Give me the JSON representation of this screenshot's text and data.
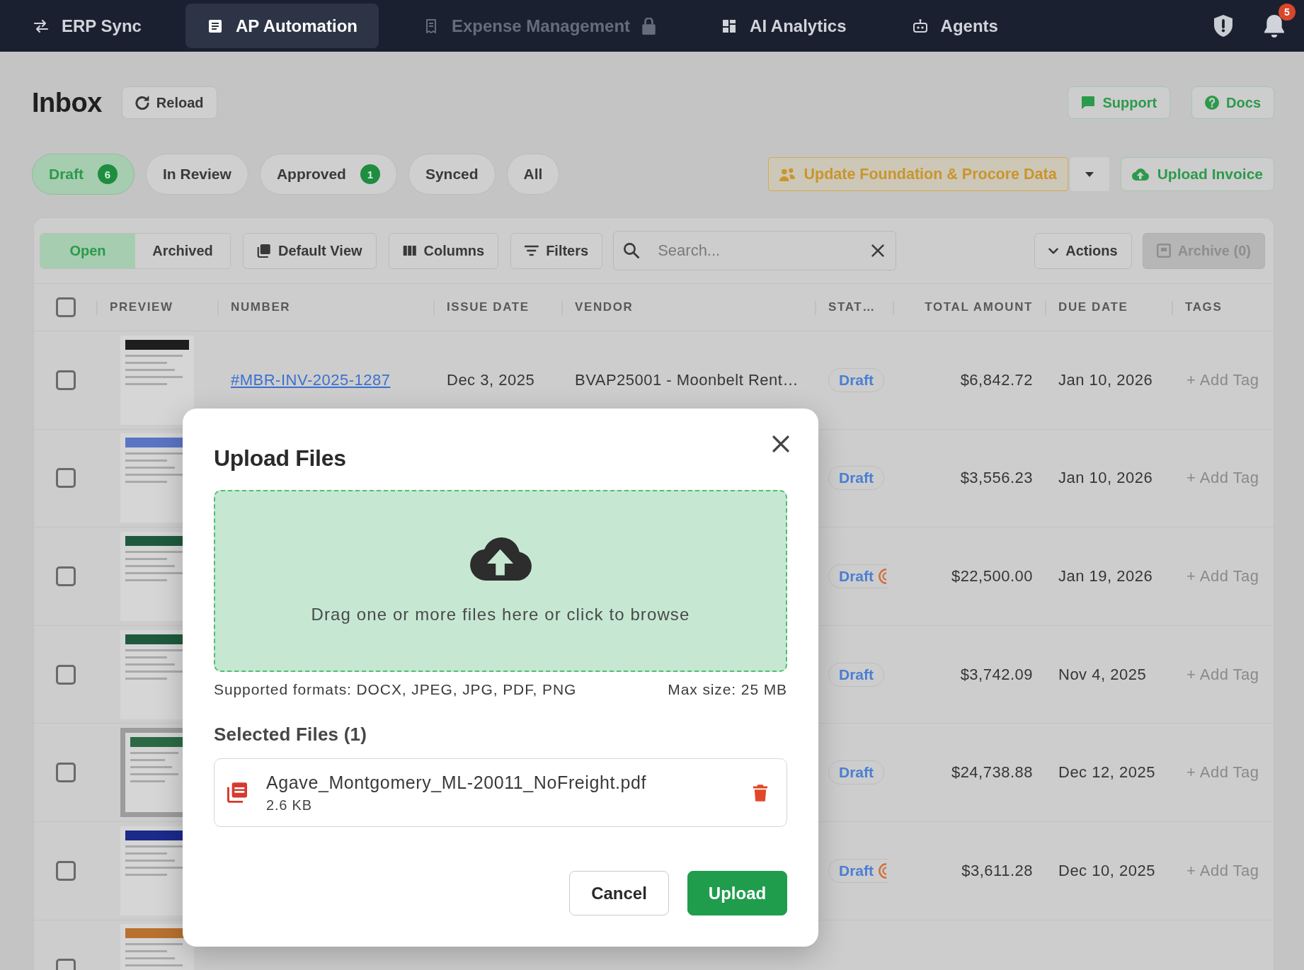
{
  "nav": {
    "items": [
      {
        "label": "ERP Sync",
        "selected": false,
        "disabled": false,
        "locked": false
      },
      {
        "label": "AP Automation",
        "selected": true,
        "disabled": false,
        "locked": false
      },
      {
        "label": "Expense Management",
        "selected": false,
        "disabled": true,
        "locked": true
      },
      {
        "label": "AI Analytics",
        "selected": false,
        "disabled": false,
        "locked": false
      },
      {
        "label": "Agents",
        "selected": false,
        "disabled": false,
        "locked": false
      }
    ],
    "notification_count": "5"
  },
  "header": {
    "title": "Inbox",
    "reload_button": "Reload",
    "links": [
      "Support",
      "Docs"
    ]
  },
  "status_filters": [
    {
      "label": "Draft",
      "count": "6",
      "selected": true
    },
    {
      "label": "In Review",
      "selected": false
    },
    {
      "label": "Approved",
      "count": "1",
      "selected": false
    },
    {
      "label": "Synced",
      "selected": false
    },
    {
      "label": "All",
      "selected": false
    }
  ],
  "actions": {
    "sync_button": "Update Foundation & Procore Data",
    "upload_button": "Upload Invoice"
  },
  "table": {
    "view_tabs": [
      {
        "label": "Open",
        "selected": true
      },
      {
        "label": "Archived",
        "selected": false
      }
    ],
    "tool_buttons": [
      "Default View",
      "Columns",
      "Filters"
    ],
    "search": {
      "placeholder": "Search..."
    },
    "actions_button": "Actions",
    "archive_button": {
      "label": "Archive (0)",
      "disabled": true
    },
    "header_checkbox": {
      "checked": false
    },
    "columns": [
      "PREVIEW",
      "NUMBER",
      "ISSUE DATE",
      "VENDOR",
      "STAT…",
      "TOTAL AMOUNT",
      "DUE DATE",
      "TAGS"
    ],
    "rows": [
      {
        "checked": false,
        "number": "#MBR-INV-2025-1287",
        "issue_date": "Dec 3, 2025",
        "vendor": "BVAP25001 - Moonbelt Rent…",
        "status": "Draft",
        "status_icon": false,
        "total": "$6,842.72",
        "due_date": "Jan 10, 2026",
        "tag_action": "+ Add Tag"
      },
      {
        "checked": false,
        "status": "Draft",
        "status_icon": false,
        "total": "$3,556.23",
        "due_date": "Jan 10, 2026",
        "tag_action": "+ Add Tag"
      },
      {
        "checked": false,
        "status": "Draft",
        "status_icon": true,
        "total": "$22,500.00",
        "due_date": "Jan 19, 2026",
        "tag_action": "+ Add Tag"
      },
      {
        "checked": false,
        "status": "Draft",
        "status_icon": false,
        "total": "$3,742.09",
        "due_date": "Nov 4, 2025",
        "tag_action": "+ Add Tag"
      },
      {
        "checked": false,
        "status": "Draft",
        "status_icon": false,
        "total": "$24,738.88",
        "due_date": "Dec 12, 2025",
        "tag_action": "+ Add Tag"
      },
      {
        "checked": false,
        "status": "Draft",
        "status_icon": true,
        "total": "$3,611.28",
        "due_date": "Dec 10, 2025",
        "tag_action": "+ Add Tag"
      },
      {
        "checked": false
      }
    ]
  },
  "modal": {
    "title": "Upload Files",
    "dropzone_text": "Drag one or more files here or click to browse",
    "formats_note": "Supported formats: DOCX, JPEG, JPG, PDF, PNG",
    "size_note": "Max size: 25 MB",
    "selected_heading": "Selected Files (1)",
    "files": [
      {
        "name": "Agave_Montgomery_ML-20011_NoFreight.pdf",
        "size": "2.6 KB"
      }
    ],
    "buttons": [
      {
        "label": "Cancel",
        "kind": "secondary"
      },
      {
        "label": "Upload",
        "kind": "primary"
      }
    ]
  }
}
